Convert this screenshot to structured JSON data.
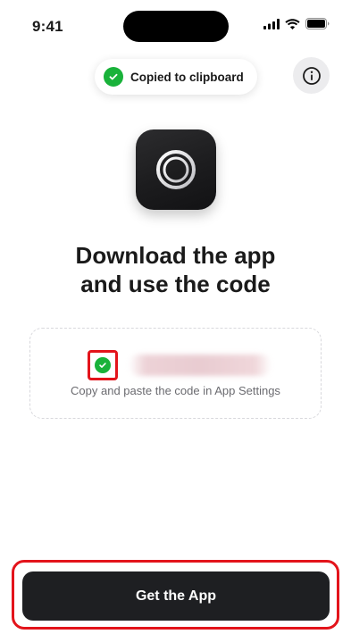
{
  "status_bar": {
    "time": "9:41",
    "icons": [
      "cellular-signal-icon",
      "wifi-icon",
      "battery-icon"
    ]
  },
  "toast": {
    "icon": "check-icon",
    "text": "Copied to clipboard"
  },
  "info_button": {
    "icon": "info-icon"
  },
  "app_icon": {
    "icon": "app-logo-icon"
  },
  "headline": {
    "line1": "Download the app",
    "line2": "and use the code"
  },
  "code_section": {
    "status_icon": "check-icon",
    "hint": "Copy and paste the code in App Settings"
  },
  "cta": {
    "label": "Get the App"
  },
  "colors": {
    "success": "#19b23a",
    "highlight": "#e3141b",
    "button_bg": "#1e1f22",
    "text": "#1a1a1a"
  }
}
